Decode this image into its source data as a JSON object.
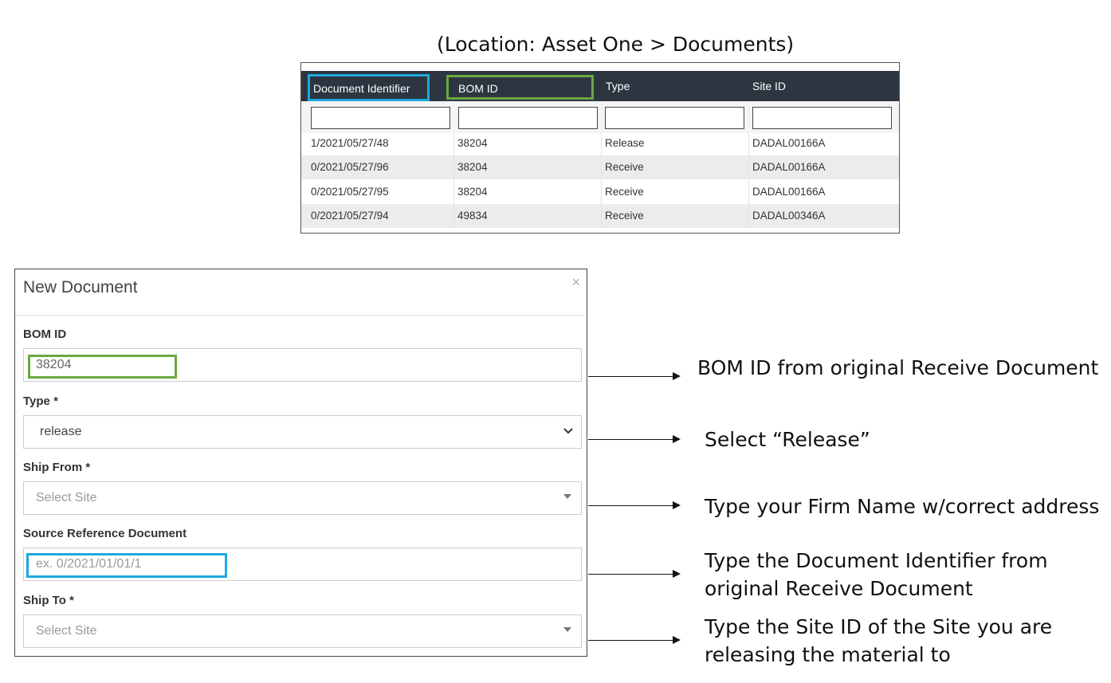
{
  "location_caption": "(Location: Asset One > Documents)",
  "table": {
    "columns": [
      "Document Identifier",
      "BOM ID",
      "Type",
      "Site ID"
    ],
    "rows": [
      [
        "1/2021/05/27/48",
        "38204",
        "Release",
        "DADAL00166A"
      ],
      [
        "0/2021/05/27/96",
        "38204",
        "Receive",
        "DADAL00166A"
      ],
      [
        "0/2021/05/27/95",
        "38204",
        "Receive",
        "DADAL00166A"
      ],
      [
        "0/2021/05/27/94",
        "49834",
        "Receive",
        "DADAL00346A"
      ]
    ]
  },
  "modal": {
    "title": "New Document",
    "close_glyph": "×",
    "fields": {
      "bom_id": {
        "label": "BOM ID",
        "value": "38204"
      },
      "type": {
        "label": "Type *",
        "value": "release"
      },
      "ship_from": {
        "label": "Ship From *",
        "placeholder": "Select Site"
      },
      "source_ref": {
        "label": "Source Reference Document",
        "placeholder": "ex. 0/2021/01/01/1"
      },
      "ship_to": {
        "label": "Ship To *",
        "placeholder": "Select Site"
      }
    }
  },
  "annotations": {
    "bom_id": "BOM ID from original Receive Document",
    "type": "Select “Release”",
    "ship_from": "Type your Firm Name w/correct address",
    "source_ref_line1": "Type the Document Identifier from",
    "source_ref_line2": "original Receive Document",
    "ship_to_line1": "Type the Site ID of the Site you are",
    "ship_to_line2": "releasing the material to"
  },
  "colors": {
    "highlight_blue": "#1ea8e0",
    "highlight_green": "#6aa840",
    "table_header": "#2d3640"
  },
  "icons": [
    "close-icon",
    "chevron-down-icon",
    "caret-down-icon",
    "arrow-right-icon"
  ]
}
